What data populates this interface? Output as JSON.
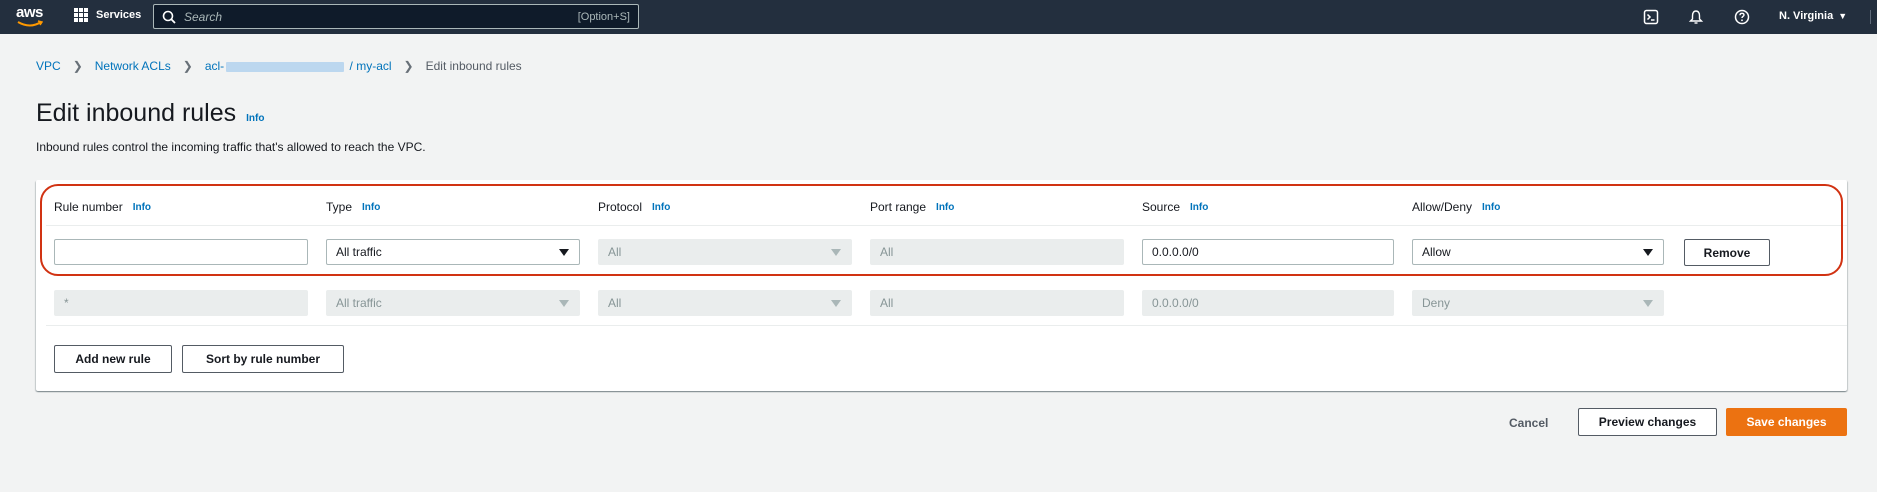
{
  "topnav": {
    "logo_text": "aws",
    "services_label": "Services",
    "search_placeholder": "Search",
    "search_shortcut": "[Option+S]",
    "region_label": "N. Virginia",
    "icons": [
      "cloudshell-icon",
      "bell-icon",
      "help-icon"
    ]
  },
  "breadcrumb": {
    "items": [
      "VPC",
      "Network ACLs"
    ],
    "acl_prefix": "acl-",
    "acl_suffix": "/ my-acl",
    "current": "Edit inbound rules"
  },
  "page": {
    "title": "Edit inbound rules",
    "title_info": "Info",
    "description": "Inbound rules control the incoming traffic that's allowed to reach the VPC."
  },
  "table": {
    "headers": [
      {
        "label": "Rule number",
        "info": "Info"
      },
      {
        "label": "Type",
        "info": "Info"
      },
      {
        "label": "Protocol",
        "info": "Info"
      },
      {
        "label": "Port range",
        "info": "Info"
      },
      {
        "label": "Source",
        "info": "Info"
      },
      {
        "label": "Allow/Deny",
        "info": "Info"
      }
    ],
    "editable_row": {
      "rule_number": "",
      "type": "All traffic",
      "protocol": "All",
      "port_range": "All",
      "source": "0.0.0.0/0",
      "allow_deny": "Allow",
      "remove_label": "Remove"
    },
    "default_row": {
      "rule_number": "*",
      "type": "All traffic",
      "protocol": "All",
      "port_range": "All",
      "source": "0.0.0.0/0",
      "allow_deny": "Deny"
    },
    "add_rule_label": "Add new rule",
    "sort_label": "Sort by rule number"
  },
  "footer": {
    "cancel_label": "Cancel",
    "preview_label": "Preview changes",
    "save_label": "Save changes"
  },
  "colors": {
    "nav_bg": "#232f3e",
    "link": "#0073bb",
    "primary": "#ec7211",
    "highlight": "#d13212"
  }
}
